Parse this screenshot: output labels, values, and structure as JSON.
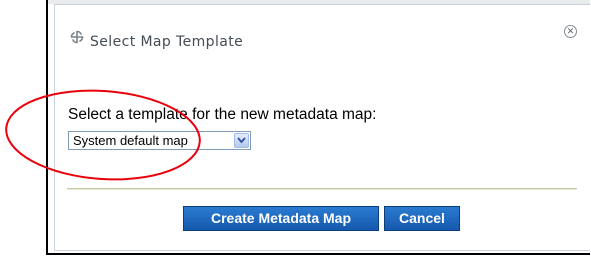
{
  "dialog": {
    "title": "Select Map Template",
    "title_icon": "swirl-logo-icon",
    "close_icon": "close-circle-icon",
    "prompt": "Select a template for the new metadata map:",
    "template_select": {
      "selected": "System default map"
    },
    "buttons": {
      "create_label": "Create Metadata Map",
      "cancel_label": "Cancel"
    }
  },
  "colors": {
    "button_blue": "#1f6bc2",
    "annotation_red": "#e8000b",
    "title_gray": "#444c55"
  }
}
